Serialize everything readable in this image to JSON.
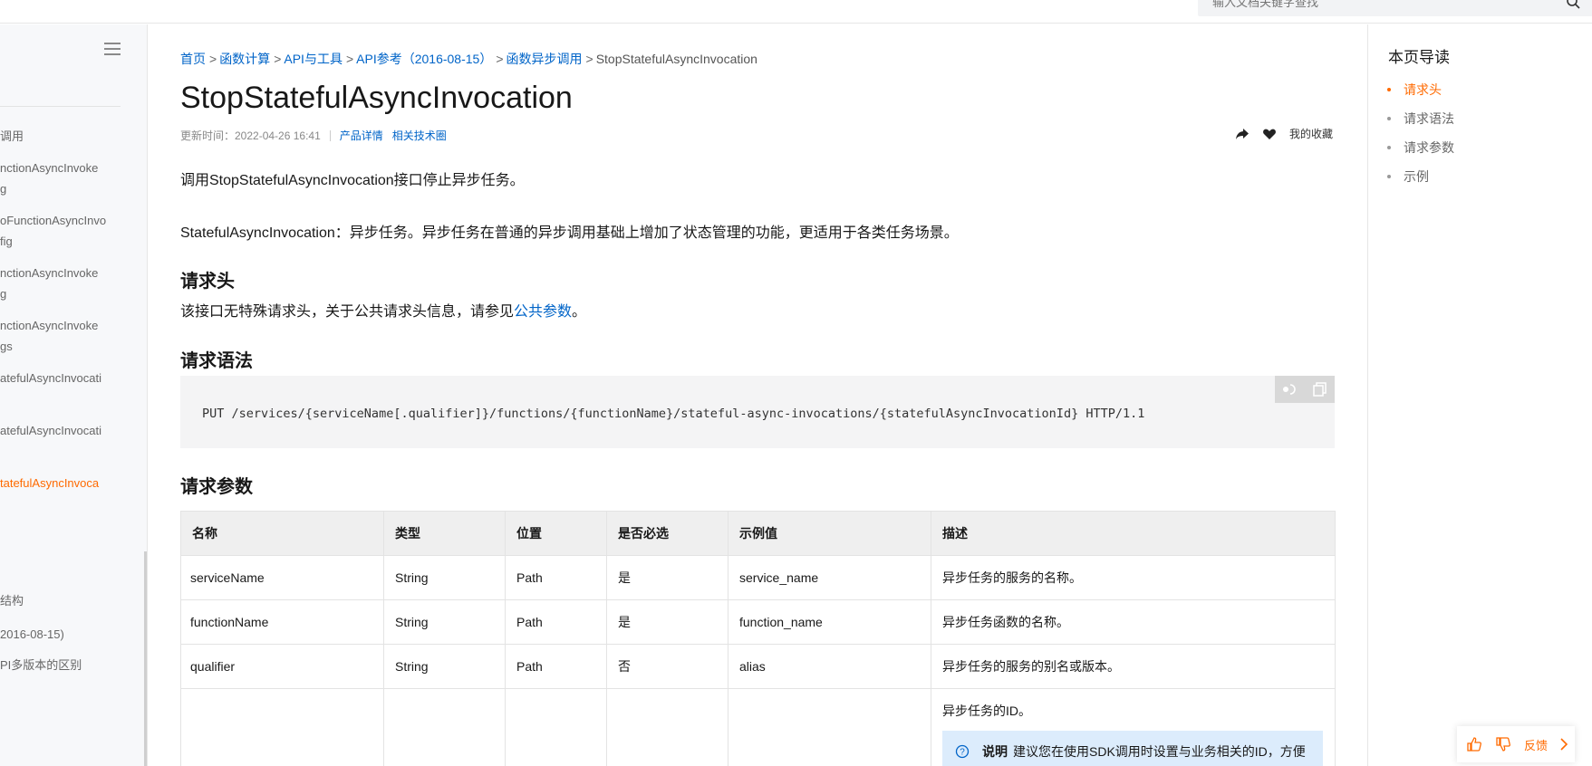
{
  "topbar": {
    "search_placeholder": "输入文档关键字查找"
  },
  "sidebar": {
    "items": [
      {
        "label": "调用",
        "active": false
      },
      {
        "label": "nctionAsyncInvoke",
        "active": false
      },
      {
        "label": "g",
        "active": false
      },
      {
        "label": "oFunctionAsyncInvo",
        "active": false
      },
      {
        "label": "fig",
        "active": false
      },
      {
        "label": "nctionAsyncInvoke",
        "active": false
      },
      {
        "label": "g",
        "active": false
      },
      {
        "label": "nctionAsyncInvoke",
        "active": false
      },
      {
        "label": "gs",
        "active": false
      },
      {
        "label": "atefulAsyncInvocati",
        "active": false
      },
      {
        "label": "atefulAsyncInvocati",
        "active": false
      },
      {
        "label": "tatefulAsyncInvoca",
        "active": true
      },
      {
        "label": "结构",
        "active": false
      },
      {
        "label": "2016-08-15)",
        "active": false
      },
      {
        "label": "PI多版本的区别",
        "active": false
      }
    ]
  },
  "breadcrumb": {
    "items": [
      "首页",
      "函数计算",
      "API与工具",
      "API参考（2016-08-15）",
      "函数异步调用"
    ],
    "current": "StopStatefulAsyncInvocation"
  },
  "page": {
    "title": "StopStatefulAsyncInvocation",
    "updated": "更新时间：2022-04-26 16:41",
    "link_product": "产品详情",
    "link_tech": "相关技术圈",
    "favorites": "我的收藏",
    "intro": "调用StopStatefulAsyncInvocation接口停止异步任务。",
    "intro2": "StatefulAsyncInvocation：异步任务。异步任务在普通的异步调用基础上增加了状态管理的功能，更适用于各类任务场景。"
  },
  "section_header": {
    "title": "请求头",
    "text_before": "该接口无特殊请求头，关于公共请求头信息，请参见",
    "link": "公共参数",
    "text_after": "。"
  },
  "section_syntax": {
    "title": "请求语法",
    "code": "PUT /services/{serviceName[.qualifier]}/functions/{functionName}/stateful-async-invocations/{statefulAsyncInvocationId} HTTP/1.1"
  },
  "section_params": {
    "title": "请求参数",
    "headers": [
      "名称",
      "类型",
      "位置",
      "是否必选",
      "示例值",
      "描述"
    ],
    "rows": [
      [
        "serviceName",
        "String",
        "Path",
        "是",
        "service_name",
        "异步任务的服务的名称。"
      ],
      [
        "functionName",
        "String",
        "Path",
        "是",
        "function_name",
        "异步任务函数的名称。"
      ],
      [
        "qualifier",
        "String",
        "Path",
        "否",
        "alias",
        "异步任务的服务的别名或版本。"
      ]
    ],
    "last_row_desc": "异步任务的ID。",
    "note_label": "说明",
    "note_text": "建议您在使用SDK调用时设置与业务相关的ID，方便"
  },
  "toc": {
    "title": "本页导读",
    "items": [
      {
        "label": "请求头",
        "active": true
      },
      {
        "label": "请求语法",
        "active": false
      },
      {
        "label": "请求参数",
        "active": false
      },
      {
        "label": "示例",
        "active": false
      }
    ]
  },
  "feedback": {
    "label": "反馈"
  },
  "colors": {
    "accent": "#ff6a00",
    "link": "#0064c8"
  }
}
